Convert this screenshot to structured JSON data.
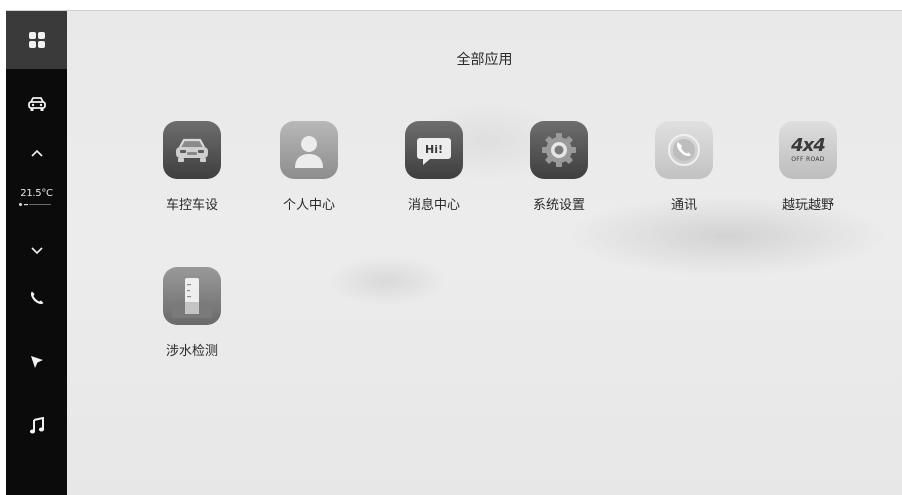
{
  "sidebar": {
    "temperature": "21.5°C",
    "icons": [
      "apps-grid-icon",
      "car-icon",
      "chevron-up-icon",
      "chevron-down-icon",
      "phone-icon",
      "navigation-arrow-icon",
      "music-note-icon"
    ]
  },
  "main": {
    "title": "全部应用",
    "apps": [
      {
        "label": "车控车设",
        "icon": "car-front-icon"
      },
      {
        "label": "个人中心",
        "icon": "person-icon"
      },
      {
        "label": "消息中心",
        "icon": "message-hi-icon"
      },
      {
        "label": "系统设置",
        "icon": "gear-icon"
      },
      {
        "label": "通讯",
        "icon": "phone-handset-icon"
      },
      {
        "label": "越玩越野",
        "icon": "offroad-4x4-icon",
        "badge_main": "4x4",
        "badge_sub": "OFF ROAD"
      },
      {
        "label": "涉水检测",
        "icon": "water-gauge-icon"
      }
    ]
  }
}
